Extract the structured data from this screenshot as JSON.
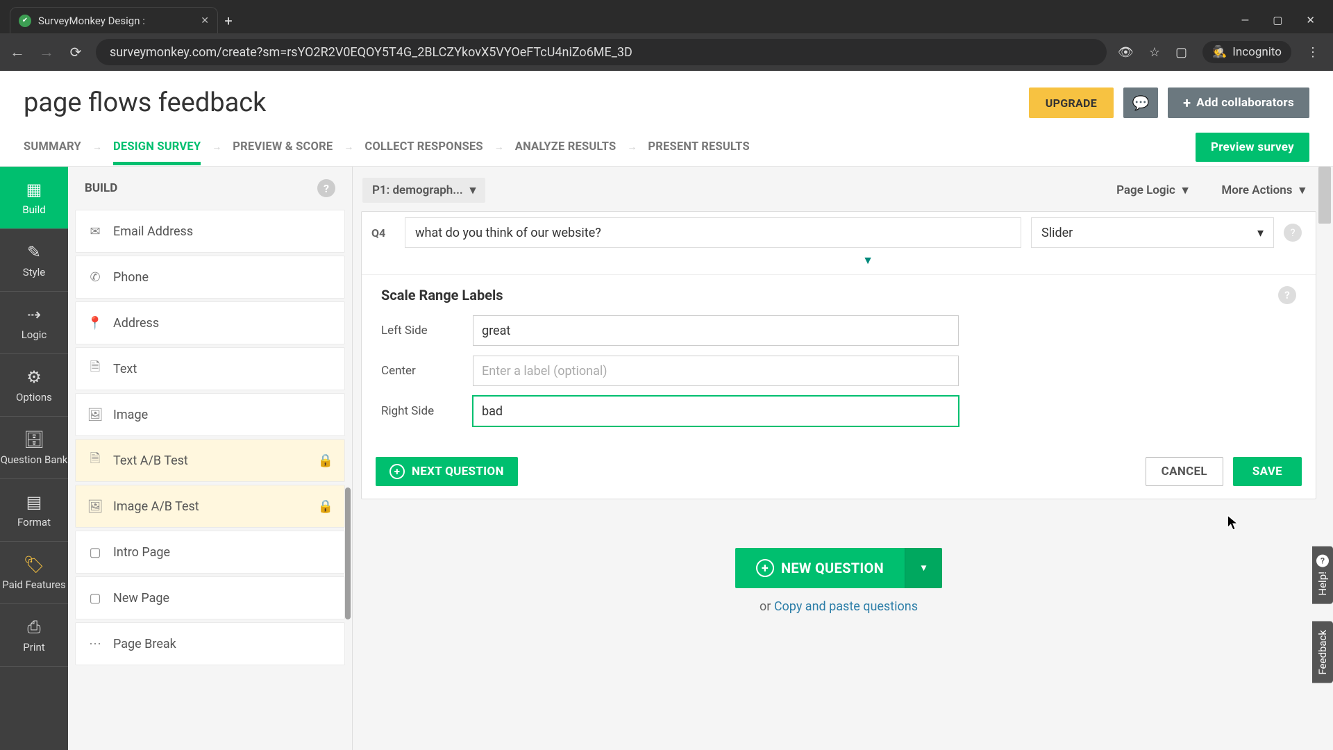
{
  "browser": {
    "tab_title": "SurveyMonkey Design :",
    "url": "surveymonkey.com/create?sm=rsYO2R2V0EQOY5T4G_2BLCZYkovX5VYOeFTcU4niZo6ME_3D",
    "incognito_label": "Incognito"
  },
  "header": {
    "survey_title": "page flows feedback",
    "upgrade": "UPGRADE",
    "collaborators": "Add collaborators"
  },
  "nav": {
    "steps": [
      "SUMMARY",
      "DESIGN SURVEY",
      "PREVIEW & SCORE",
      "COLLECT RESPONSES",
      "ANALYZE RESULTS",
      "PRESENT RESULTS"
    ],
    "active_index": 1,
    "preview": "Preview survey"
  },
  "rail": [
    {
      "label": "Build",
      "icon": "▦",
      "sel": true
    },
    {
      "label": "Style",
      "icon": "✎"
    },
    {
      "label": "Logic",
      "icon": "⇢"
    },
    {
      "label": "Options",
      "icon": "⚙"
    },
    {
      "label": "Question Bank",
      "icon": "🗄"
    },
    {
      "label": "Format",
      "icon": "▤"
    },
    {
      "label": "Paid Features",
      "icon": "🏷",
      "paid": true
    },
    {
      "label": "Print",
      "icon": "⎙"
    }
  ],
  "build": {
    "title": "BUILD",
    "items": [
      {
        "label": "Email Address",
        "icon": "✉"
      },
      {
        "label": "Phone",
        "icon": "✆"
      },
      {
        "label": "Address",
        "icon": "📍"
      },
      {
        "label": "Text",
        "icon": "🗎"
      },
      {
        "label": "Image",
        "icon": "🖼"
      },
      {
        "label": "Text A/B Test",
        "icon": "🗎",
        "locked": true
      },
      {
        "label": "Image A/B Test",
        "icon": "🖼",
        "locked": true
      },
      {
        "label": "Intro Page",
        "icon": "▢"
      },
      {
        "label": "New Page",
        "icon": "▢"
      },
      {
        "label": "Page Break",
        "icon": "⋯"
      }
    ]
  },
  "canvas": {
    "page_dropdown": "P1: demograph...",
    "page_logic": "Page Logic",
    "more_actions": "More Actions",
    "question": {
      "num": "Q4",
      "text": "what do you think of our website?",
      "type": "Slider"
    },
    "scale": {
      "heading": "Scale Range Labels",
      "left_label": "Left Side",
      "left_value": "great",
      "center_label": "Center",
      "center_placeholder": "Enter a label (optional)",
      "right_label": "Right Side",
      "right_value": "bad"
    },
    "actions": {
      "next": "NEXT QUESTION",
      "cancel": "CANCEL",
      "save": "SAVE"
    },
    "newq": "NEW QUESTION",
    "or_text": "or ",
    "copy_link": "Copy and paste questions"
  },
  "floaters": {
    "help": "Help!",
    "feedback": "Feedback"
  }
}
